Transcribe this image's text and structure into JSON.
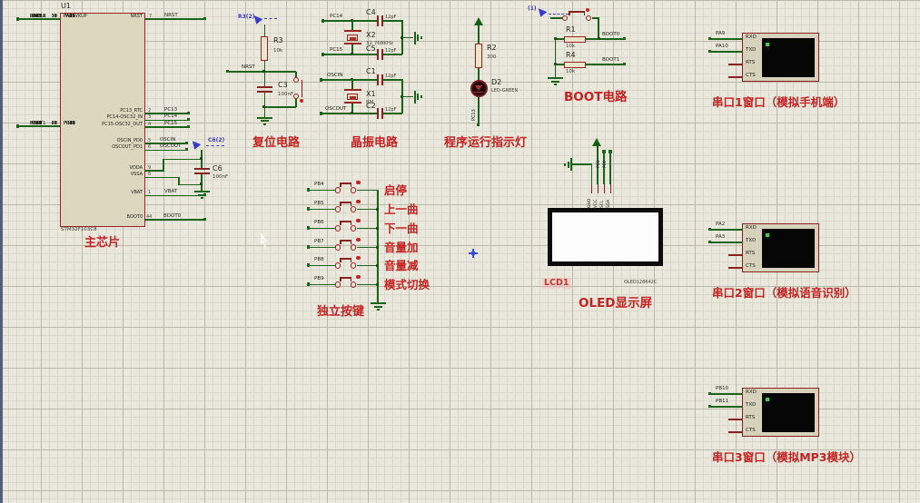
{
  "chip": {
    "ref": "U1",
    "part": "STM32F103C8",
    "caption": "主芯片",
    "pins_a": [
      {
        "net": "PA0",
        "num": "10",
        "name": "PA0-WKUP"
      },
      {
        "net": "PA1",
        "num": "11",
        "name": "PA1"
      },
      {
        "net": "PA2",
        "num": "12",
        "name": "PA2"
      },
      {
        "net": "PA3",
        "num": "13",
        "name": "PA3"
      },
      {
        "net": "PA4",
        "num": "14",
        "name": "PA4"
      },
      {
        "net": "PA5",
        "num": "15",
        "name": "PA5"
      },
      {
        "net": "PA6",
        "num": "16",
        "name": "PA6"
      },
      {
        "net": "PA7",
        "num": "17",
        "name": "PA7"
      },
      {
        "net": "PA8",
        "num": "29",
        "name": "PA8"
      },
      {
        "net": "PA9",
        "num": "30",
        "name": "PA9"
      },
      {
        "net": "PA10",
        "num": "31",
        "name": "PA10"
      },
      {
        "net": "PA11",
        "num": "32",
        "name": "PA11"
      },
      {
        "net": "PA12",
        "num": "33",
        "name": "PA12"
      },
      {
        "net": "SWDIO",
        "num": "34",
        "name": "PA13"
      },
      {
        "net": "SWCLK",
        "num": "37",
        "name": "PA14"
      },
      {
        "net": "PA15",
        "num": "38",
        "name": "PA15"
      }
    ],
    "pins_b": [
      {
        "net": "PB0",
        "num": "18",
        "name": "PB0"
      },
      {
        "net": "PB1",
        "num": "19",
        "name": "PB1"
      },
      {
        "net": "BOOT1",
        "num": "20",
        "name": "PB2"
      },
      {
        "net": "PB3",
        "num": "39",
        "name": "PB3"
      },
      {
        "net": "PB4",
        "num": "40",
        "name": "PB4"
      },
      {
        "net": "PB5",
        "num": "41",
        "name": "PB5"
      },
      {
        "net": "PB6",
        "num": "42",
        "name": "PB6"
      },
      {
        "net": "PB7",
        "num": "43",
        "name": "PB7"
      },
      {
        "net": "PB8",
        "num": "45",
        "name": "PB8"
      },
      {
        "net": "PB9",
        "num": "46",
        "name": "PB9"
      },
      {
        "net": "PB10",
        "num": "21",
        "name": "PB10"
      },
      {
        "net": "PB11",
        "num": "22",
        "name": "PB11"
      },
      {
        "net": "PB12",
        "num": "25",
        "name": "PB12"
      },
      {
        "net": "PB13",
        "num": "26",
        "name": "PB13"
      },
      {
        "net": "PB14",
        "num": "27",
        "name": "PB14"
      },
      {
        "net": "PB15",
        "num": "28",
        "name": "PB15"
      }
    ],
    "right": {
      "nrst": {
        "name": "NRST",
        "num": "7",
        "net": "NRST"
      },
      "pc13": {
        "name": "PC13_RTC",
        "num": "2",
        "net": "PC13"
      },
      "pc14": {
        "name": "PC14-OSC32_IN",
        "num": "3",
        "net": "PC14"
      },
      "pc15": {
        "name": "PC15-OSC32_OUT",
        "num": "4",
        "net": "PC15"
      },
      "oscin": {
        "name": "OSCIN_PD0",
        "num": "5",
        "net": "OSCIN"
      },
      "oscout": {
        "name": "OSCOUT_PD1",
        "num": "6",
        "net": "OSCOUT"
      },
      "vdda": {
        "name": "VDDA",
        "num": "9"
      },
      "vssa": {
        "name": "VSSA",
        "num": "8"
      },
      "vbat": {
        "name": "VBAT",
        "num": "1",
        "net": "VBAT"
      },
      "boot0": {
        "name": "BOOT0",
        "num": "44",
        "net": "BOOT0"
      }
    },
    "c6": {
      "ref": "C6",
      "val": "100nF",
      "probe": "C6(2)"
    }
  },
  "reset": {
    "caption": "复位电路",
    "probe": "R3(2)",
    "net": "NRST",
    "r": {
      "ref": "R3",
      "val": "10k"
    },
    "c": {
      "ref": "C3",
      "val": "100nF"
    }
  },
  "crystal": {
    "caption": "晶振电路",
    "x2": {
      "ref": "X2",
      "val": "32.768KHz",
      "net_top": "PC14",
      "net_bot": "PC15",
      "c_top": {
        "ref": "C4",
        "val": "12pF"
      },
      "c_bot": {
        "ref": "C5",
        "val": "12pF"
      }
    },
    "x1": {
      "ref": "X1",
      "val": "8M",
      "net_top": "OSCIN",
      "net_bot": "OSCOUT",
      "c_top": {
        "ref": "C1",
        "val": "12pF"
      },
      "c_bot": {
        "ref": "C2",
        "val": "12pF"
      }
    }
  },
  "indicator": {
    "caption": "程序运行指示灯",
    "net": "PC13",
    "r": {
      "ref": "R2",
      "val": "300"
    },
    "led": {
      "ref": "D2",
      "val": "LED-GREEN"
    }
  },
  "boot": {
    "caption": "BOOT电路",
    "probe": "(1)",
    "r1": {
      "ref": "R1",
      "val": "10k",
      "net": "BOOT0"
    },
    "r4": {
      "ref": "R4",
      "val": "10k",
      "net": "BOOT1"
    }
  },
  "keys": {
    "caption": "独立按键",
    "items": [
      {
        "net": "PB4",
        "label": "启停"
      },
      {
        "net": "PB5",
        "label": "上一曲"
      },
      {
        "net": "PB6",
        "label": "下一曲"
      },
      {
        "net": "PB7",
        "label": "音量加"
      },
      {
        "net": "PB8",
        "label": "音量减"
      },
      {
        "net": "PB9",
        "label": "模式切换"
      }
    ]
  },
  "oled": {
    "caption": "OLED显示屏",
    "ref": "LCD1",
    "part": "OLED128642C",
    "pins": [
      "GND",
      "VCC",
      "SCL",
      "SDA"
    ],
    "nets": [
      "PB1",
      "PB0"
    ]
  },
  "serials": [
    {
      "caption": "串口1窗口（模拟手机端）",
      "nets": [
        "PA9",
        "PA10"
      ],
      "pins": [
        "RXD",
        "TXD",
        "RTS",
        "CTS"
      ]
    },
    {
      "caption": "串口2窗口（模拟语音识别）",
      "nets": [
        "PA2",
        "PA3"
      ],
      "pins": [
        "RXD",
        "TXD",
        "RTS",
        "CTS"
      ]
    },
    {
      "caption": "串口3窗口（模拟MP3模块）",
      "nets": [
        "PB10",
        "PB11"
      ],
      "pins": [
        "RXD",
        "TXD",
        "RTS",
        "CTS"
      ]
    }
  ],
  "colors": {
    "wire": "#1b651b",
    "component_outline": "#9c2121",
    "caption_red": "#c52222",
    "probe_blue": "#3a3acc",
    "canvas": "#eae8dc",
    "screen_dot": "#2fdd2f"
  }
}
